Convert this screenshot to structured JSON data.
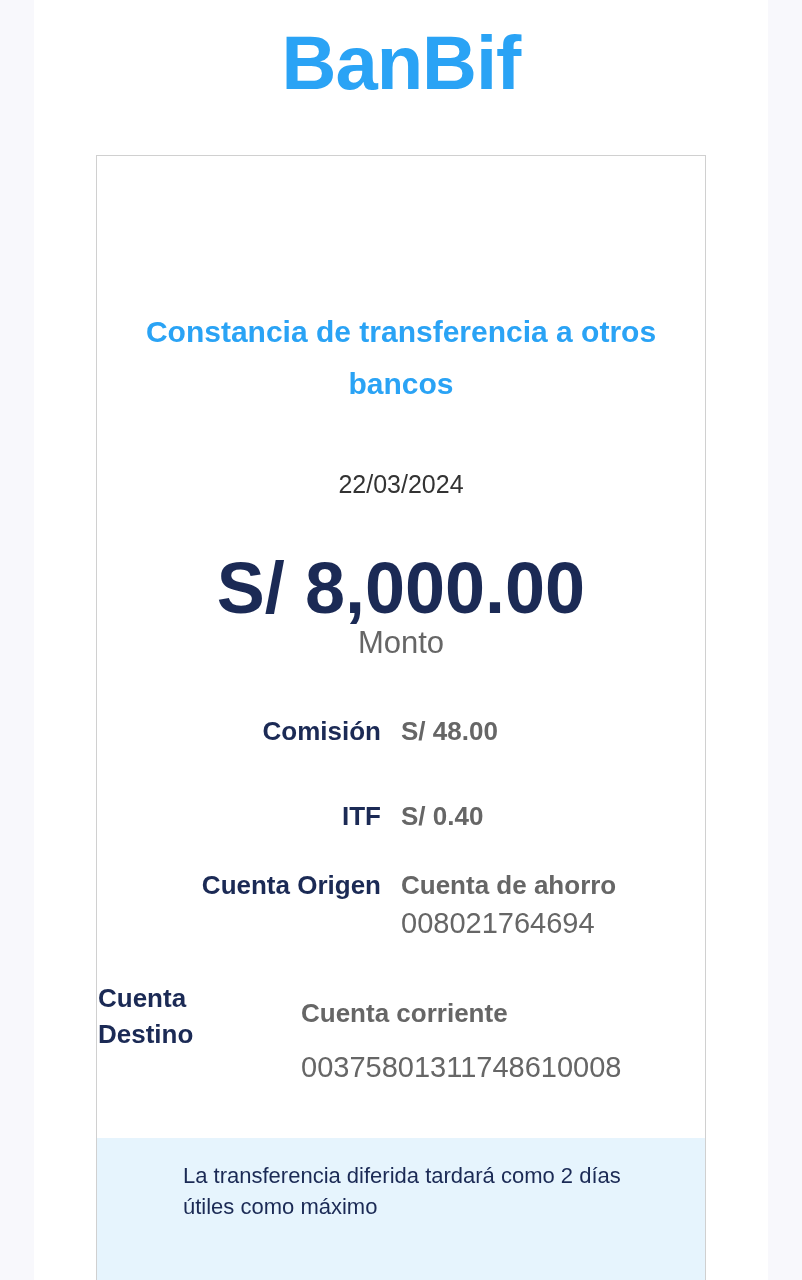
{
  "logo": {
    "text": "BanBif"
  },
  "receipt": {
    "title": "Constancia de transferencia a otros bancos",
    "date": "22/03/2024",
    "amount": "S/ 8,000.00",
    "amount_label": "Monto",
    "details": [
      {
        "kind": "inline",
        "label": "Comisión",
        "value": "S/ 48.00"
      },
      {
        "kind": "inline",
        "label": "ITF",
        "value": "S/ 0.40"
      },
      {
        "kind": "account",
        "label": "Cuenta Origen",
        "value": "Cuenta de ahorro",
        "number": "008021764694"
      },
      {
        "kind": "wide",
        "label": "Cuenta Destino",
        "value": "Cuenta corriente",
        "number": "00375801311748610008"
      }
    ],
    "notice": "La transferencia diferida tardará como 2 días útiles como máximo"
  }
}
